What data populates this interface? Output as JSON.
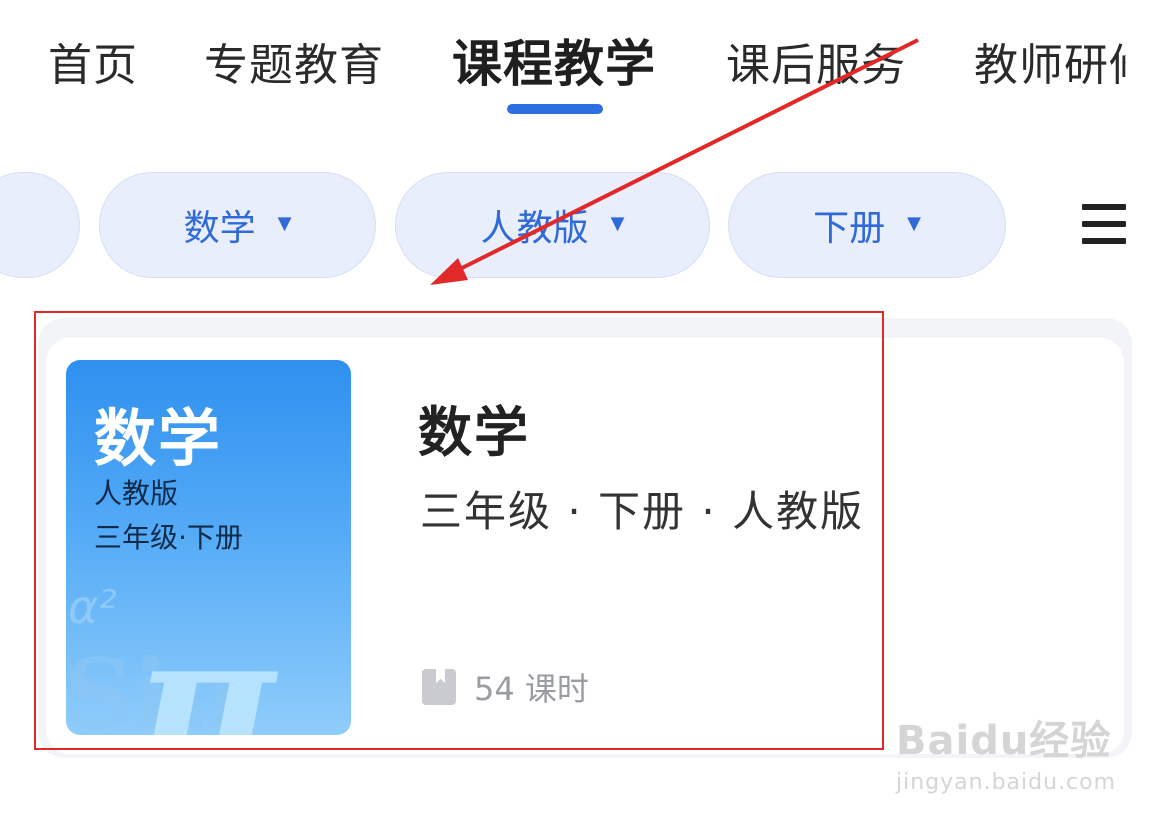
{
  "tabs": [
    {
      "label": "首页"
    },
    {
      "label": "专题教育"
    },
    {
      "label": "课程教学"
    },
    {
      "label": "课后服务"
    },
    {
      "label": "教师研修"
    }
  ],
  "active_tab": "课程教学",
  "filters": [
    {
      "label": "数学",
      "caret": "▼"
    },
    {
      "label": "人教版",
      "caret": "▼"
    },
    {
      "label": "下册",
      "caret": "▼"
    }
  ],
  "menu_icon": "hamburger-menu-icon",
  "course": {
    "cover": {
      "title": "数学",
      "edition": "人教版",
      "grade": "三年级·下册",
      "decor_pi": "π",
      "decor_sin": "Sin",
      "decor_a": "α²"
    },
    "title": "数学",
    "meta": "三年级 · 下册 · 人教版",
    "lessons": "54 课时",
    "lessons_icon": "book-icon"
  },
  "annotation": {
    "color": "#e02a2a"
  },
  "accent_color": "#2e6fe0",
  "watermark": {
    "brand": "Baidu经验",
    "url": "jingyan.baidu.com"
  }
}
